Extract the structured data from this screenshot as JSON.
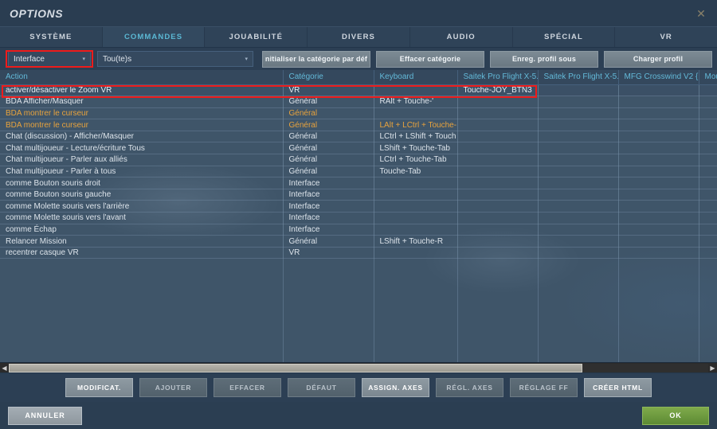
{
  "window": {
    "title": "OPTIONS",
    "close_icon": "close-icon",
    "close_glyph": "✕"
  },
  "tabs": [
    {
      "label": "SYSTÈME",
      "active": false
    },
    {
      "label": "COMMANDES",
      "active": true
    },
    {
      "label": "JOUABILITÉ",
      "active": false
    },
    {
      "label": "DIVERS",
      "active": false
    },
    {
      "label": "AUDIO",
      "active": false
    },
    {
      "label": "SPÉCIAL",
      "active": false
    },
    {
      "label": "VR",
      "active": false
    }
  ],
  "toolbar": {
    "category_filter": "Interface",
    "device_filter": "Tou(te)s",
    "caret_glyph": "▾",
    "buttons": [
      "nitialiser la catégorie par déf",
      "Effacer catégorie",
      "Enreg. profil sous",
      "Charger profil"
    ]
  },
  "table": {
    "columns": [
      "Action",
      "Catégorie",
      "Keyboard",
      "Saitek Pro Flight X-5...",
      "Saitek Pro Flight X-5...",
      "MFG Crosswind V2 {...",
      "Mou"
    ],
    "rows": [
      {
        "action": "activer/désactiver le Zoom VR",
        "category": "VR",
        "keyboard": "",
        "dev1": "Touche-JOY_BTN3",
        "dev2": "",
        "dev3": "",
        "dev4": "",
        "style": "selected"
      },
      {
        "action": "BDA Afficher/Masquer",
        "category": "Général",
        "keyboard": "RAlt + Touche-'",
        "dev1": "",
        "dev2": "",
        "dev3": "",
        "dev4": "",
        "style": "normal"
      },
      {
        "action": "BDA montrer le curseur",
        "category": "Général",
        "keyboard": "",
        "dev1": "",
        "dev2": "",
        "dev3": "",
        "dev4": "",
        "style": "warn"
      },
      {
        "action": "BDA montrer le curseur",
        "category": "Général",
        "keyboard": "LAlt + LCtrl + Touche-",
        "dev1": "",
        "dev2": "",
        "dev3": "",
        "dev4": "",
        "style": "warn"
      },
      {
        "action": "Chat (discussion) - Afficher/Masquer",
        "category": "Général",
        "keyboard": "LCtrl + LShift + Touch",
        "dev1": "",
        "dev2": "",
        "dev3": "",
        "dev4": "",
        "style": "normal"
      },
      {
        "action": "Chat multijoueur - Lecture/écriture Tous",
        "category": "Général",
        "keyboard": "LShift + Touche-Tab",
        "dev1": "",
        "dev2": "",
        "dev3": "",
        "dev4": "",
        "style": "normal"
      },
      {
        "action": "Chat multijoueur - Parler aux alliés",
        "category": "Général",
        "keyboard": "LCtrl + Touche-Tab",
        "dev1": "",
        "dev2": "",
        "dev3": "",
        "dev4": "",
        "style": "normal"
      },
      {
        "action": "Chat multijoueur - Parler à tous",
        "category": "Général",
        "keyboard": "Touche-Tab",
        "dev1": "",
        "dev2": "",
        "dev3": "",
        "dev4": "",
        "style": "normal"
      },
      {
        "action": "comme Bouton souris droit",
        "category": "Interface",
        "keyboard": "",
        "dev1": "",
        "dev2": "",
        "dev3": "",
        "dev4": "",
        "style": "normal"
      },
      {
        "action": "comme Bouton souris gauche",
        "category": "Interface",
        "keyboard": "",
        "dev1": "",
        "dev2": "",
        "dev3": "",
        "dev4": "",
        "style": "normal"
      },
      {
        "action": "comme Molette souris vers l'arrière",
        "category": "Interface",
        "keyboard": "",
        "dev1": "",
        "dev2": "",
        "dev3": "",
        "dev4": "",
        "style": "normal"
      },
      {
        "action": "comme Molette souris vers l'avant",
        "category": "Interface",
        "keyboard": "",
        "dev1": "",
        "dev2": "",
        "dev3": "",
        "dev4": "",
        "style": "normal"
      },
      {
        "action": "comme Échap",
        "category": "Interface",
        "keyboard": "",
        "dev1": "",
        "dev2": "",
        "dev3": "",
        "dev4": "",
        "style": "normal"
      },
      {
        "action": "Relancer Mission",
        "category": "Général",
        "keyboard": "LShift + Touche-R",
        "dev1": "",
        "dev2": "",
        "dev3": "",
        "dev4": "",
        "style": "normal"
      },
      {
        "action": "recentrer casque VR",
        "category": "VR",
        "keyboard": "",
        "dev1": "",
        "dev2": "",
        "dev3": "",
        "dev4": "",
        "style": "normal"
      }
    ]
  },
  "scrollbar": {
    "left_arrow": "◀",
    "right_arrow": "▶",
    "thumb_percent": 82
  },
  "action_buttons": [
    {
      "label": "MODIFICAT.",
      "state": "on"
    },
    {
      "label": "AJOUTER",
      "state": "dim"
    },
    {
      "label": "EFFACER",
      "state": "dim"
    },
    {
      "label": "DÉFAUT",
      "state": "dim"
    },
    {
      "label": "ASSIGN. AXES",
      "state": "on"
    },
    {
      "label": "RÉGL. AXES",
      "state": "dim"
    },
    {
      "label": "RÉGLAGE FF",
      "state": "dim"
    },
    {
      "label": "CRÉER HTML",
      "state": "on"
    }
  ],
  "footer": {
    "cancel_label": "ANNULER",
    "ok_label": "OK"
  },
  "colors": {
    "accent_cyan": "#63b9d8",
    "warn_orange": "#e8a33d",
    "highlight_red": "#ee1b1b",
    "ok_green": "#6d9a40",
    "panel_bg": "#2c3f54"
  }
}
